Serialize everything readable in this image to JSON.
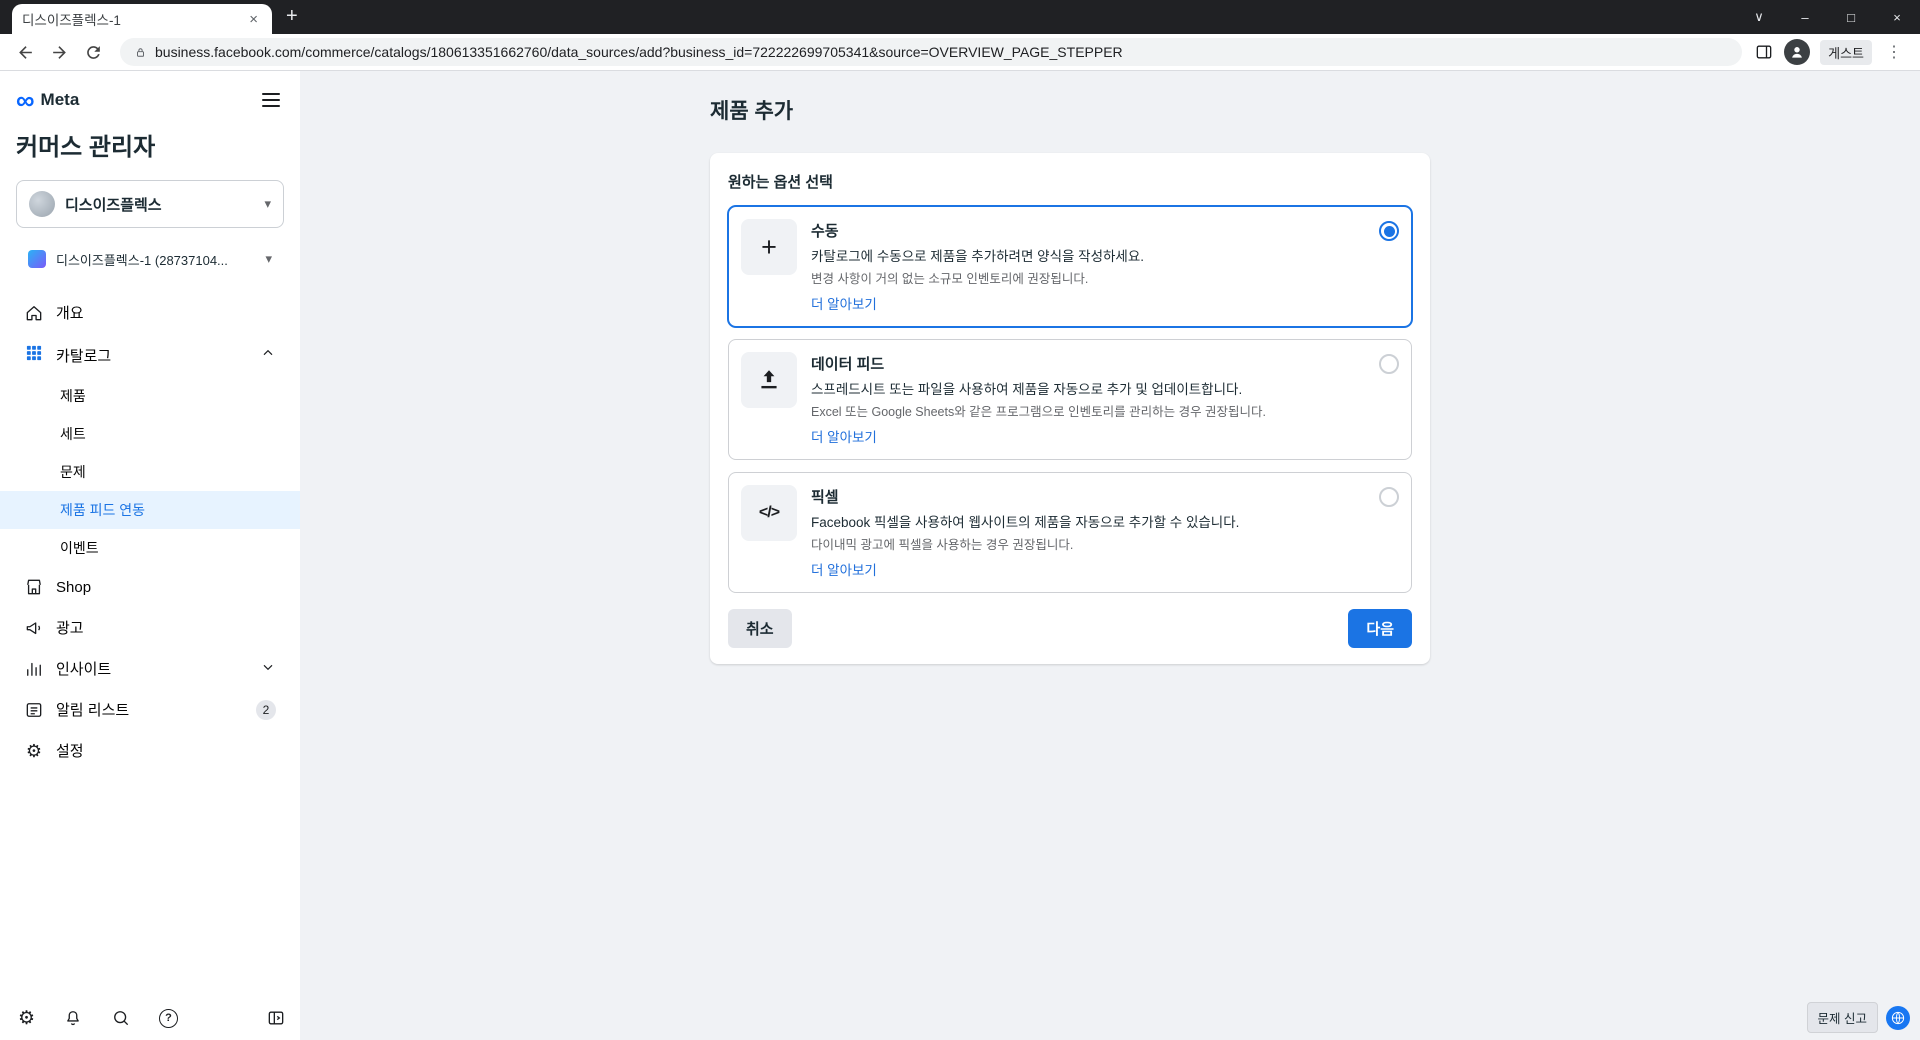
{
  "browser": {
    "tab_title": "디스이즈플렉스-1",
    "url": "business.facebook.com/commerce/catalogs/180613351662760/data_sources/add?business_id=722222699705341&source=OVERVIEW_PAGE_STEPPER",
    "profile_label": "게스트"
  },
  "icons": {
    "plus": "+",
    "close": "×",
    "minimize": "–",
    "maximize": "□",
    "chevron": "∨",
    "kebab": "⋮",
    "caret_down": "▾",
    "infinity": "∞",
    "gear": "⚙",
    "question": "?"
  },
  "sidebar": {
    "brand": "Meta",
    "app_title": "커머스 관리자",
    "business_selector": {
      "label": "디스이즈플렉스"
    },
    "catalog_selector": {
      "label": "디스이즈플렉스-1 (28737104..."
    },
    "nav_overview": "개요",
    "nav_catalog": "카탈로그",
    "catalog_children": [
      "제품",
      "세트",
      "문제",
      "제품 피드 연동",
      "이벤트"
    ],
    "active_child": "제품 피드 연동",
    "nav_shop": "Shop",
    "nav_ads": "광고",
    "nav_insights": "인사이트",
    "nav_alerts": "알림 리스트",
    "alerts_badge": "2",
    "nav_settings": "설정"
  },
  "main": {
    "page_title": "제품 추가",
    "card_title": "원하는 옵션 선택",
    "options": [
      {
        "title": "수동",
        "desc": "카탈로그에 수동으로 제품을 추가하려면 양식을 작성하세요.",
        "note": "변경 사항이 거의 없는 소규모 인벤토리에 권장됩니다.",
        "link": "더 알아보기",
        "glyph": "+",
        "selected": true
      },
      {
        "title": "데이터 피드",
        "desc": "스프레드시트 또는 파일을 사용하여 제품을 자동으로 추가 및 업데이트합니다.",
        "note": "Excel 또는 Google Sheets와 같은 프로그램으로 인벤토리를 관리하는 경우 권장됩니다.",
        "link": "더 알아보기",
        "selected": false
      },
      {
        "title": "픽셀",
        "desc": "Facebook 픽셀을 사용하여 웹사이트의 제품을 자동으로 추가할 수 있습니다.",
        "note": "다이내믹 광고에 픽셀을 사용하는 경우 권장됩니다.",
        "link": "더 알아보기",
        "glyph": "</>",
        "selected": false
      }
    ],
    "cancel_label": "취소",
    "next_label": "다음"
  },
  "floating": {
    "report_label": "문제 신고"
  },
  "colors": {
    "accent": "#1b74e4",
    "meta_blue": "#0866ff",
    "sidebar_active_bg": "#e7f3ff",
    "content_bg": "#f0f2f5",
    "frame": "#202124"
  }
}
